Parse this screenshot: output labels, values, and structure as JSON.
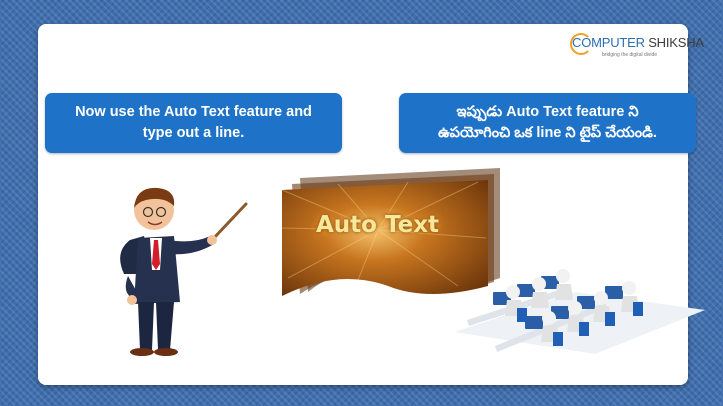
{
  "logo": {
    "part1": "COMPUTER",
    "part2": " SHIKSHA",
    "tagline": "bridging the digital divide"
  },
  "instruction_english": {
    "line1": "Now use the Auto Text feature and",
    "line2": "type out a line."
  },
  "instruction_telugu": {
    "line1": "ఇప్పుడు Auto Text feature ని",
    "line2": "ఉపయోగించి ఒక line ని టైప్ చేయండి."
  },
  "banner": {
    "text": "Auto Text"
  },
  "colors": {
    "background": "#3f6fb0",
    "box_blue": "#1e73c8",
    "logo_blue": "#2a6fb4",
    "banner_brown": "#8a4a12"
  }
}
